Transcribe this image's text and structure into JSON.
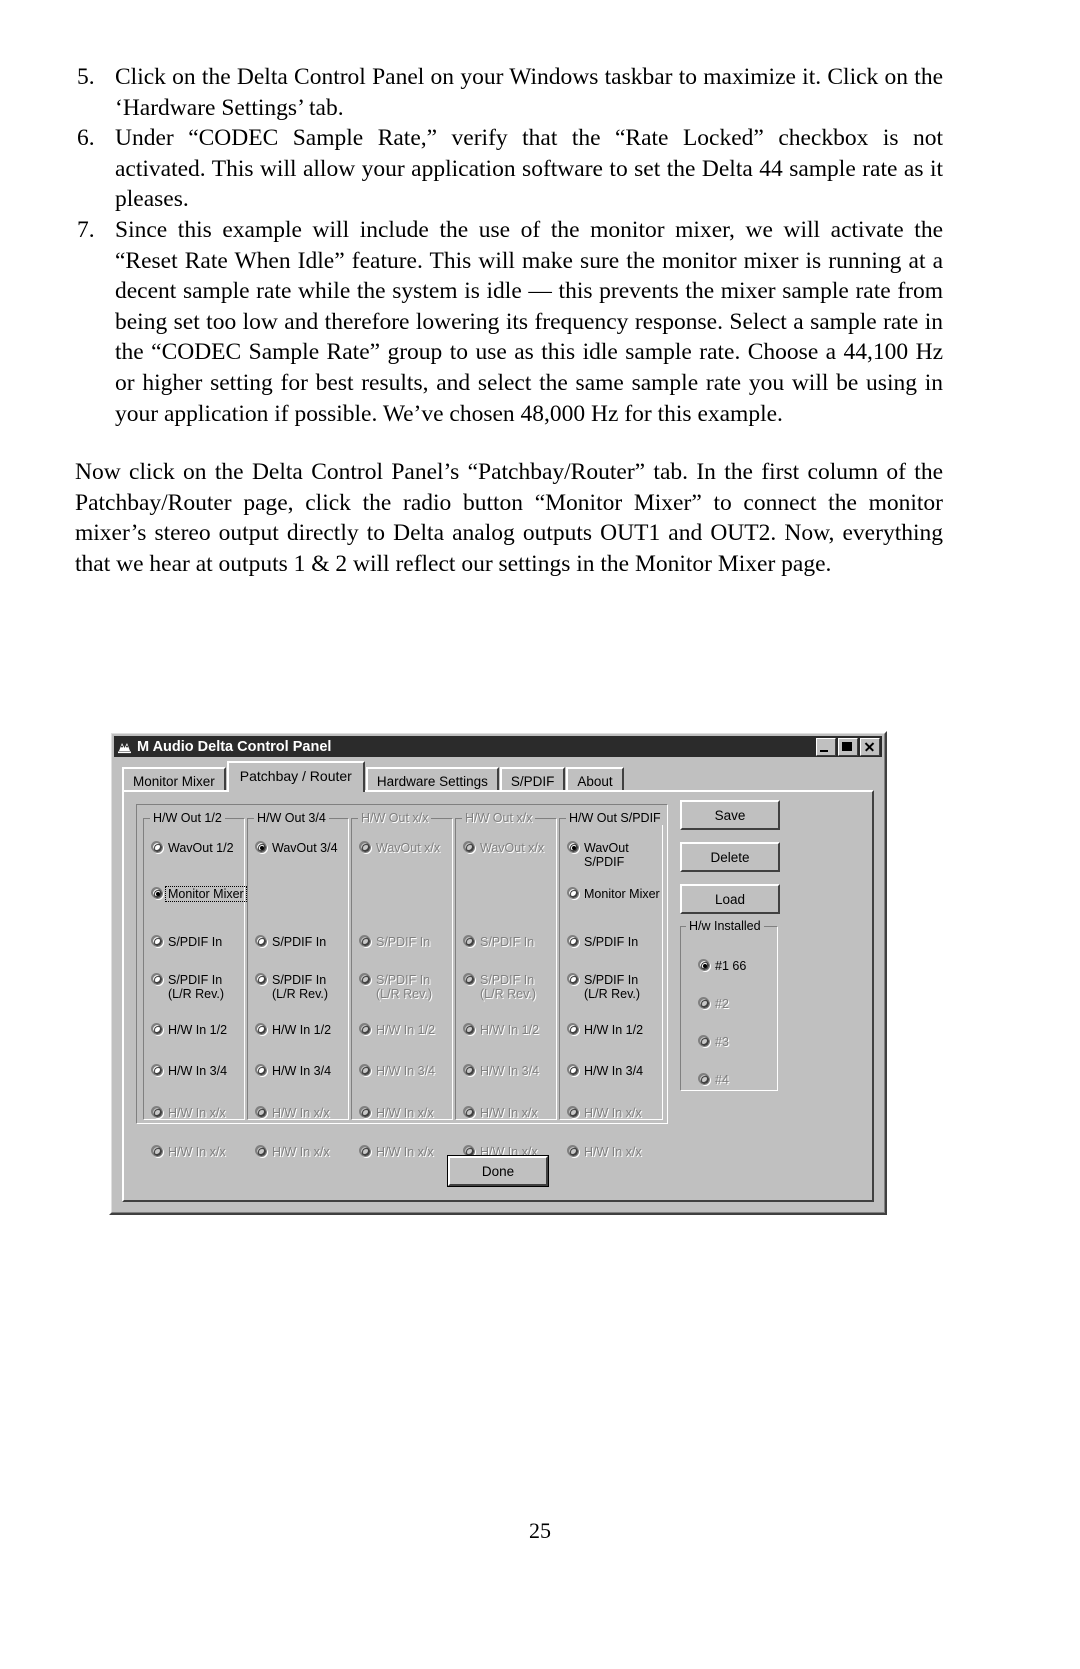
{
  "document": {
    "numbered_items": [
      {
        "num": "5.",
        "text": "Click on the Delta Control Panel on your Windows taskbar to maximize it.  Click on the ‘Hardware Settings’ tab."
      },
      {
        "num": "6.",
        "text": "Under “CODEC Sample Rate,” verify that the “Rate Locked” checkbox is not activated.  This will allow your application software to set the Delta 44 sample rate as it pleases."
      },
      {
        "num": "7.",
        "text": "Since this example will include the use of the monitor mixer, we will activate the “Reset Rate When Idle” feature.  This will make sure the monitor mixer is running at a decent sample rate while the system is idle — this prevents the mixer sample rate from being set too low and therefore lowering its frequency response.  Select a sample rate in the “CODEC Sample Rate” group to use as this idle sample rate.  Choose a 44,100 Hz or higher setting for best results, and select the same sample rate you will be using in your application if possible. We’ve chosen 48,000 Hz for this example."
      }
    ],
    "paragraph": "Now click on the Delta Control Panel’s “Patchbay/Router” tab.  In the first column of the Patchbay/Router page, click the radio button “Monitor Mixer” to connect the monitor mixer’s stereo output directly to Delta analog outputs OUT1 and OUT2. Now, everything that we hear at outputs 1 & 2 will reflect our settings in the Monitor Mixer page.",
    "page_number": "25"
  },
  "dialog": {
    "title": "M Audio Delta Control Panel",
    "title_icon": "m-audio-logo-icon",
    "window_buttons": [
      {
        "name": "minimize-button",
        "glyph": "minimize-icon"
      },
      {
        "name": "maximize-button",
        "glyph": "maximize-icon"
      },
      {
        "name": "close-button",
        "glyph": "close-icon"
      }
    ],
    "tabs": [
      {
        "label": "Monitor Mixer",
        "active": false
      },
      {
        "label": "Patchbay / Router",
        "active": true
      },
      {
        "label": "Hardware Settings",
        "active": false
      },
      {
        "label": "S/PDIF",
        "active": false
      },
      {
        "label": "About",
        "active": false
      }
    ],
    "columns": [
      {
        "title": "H/W Out 1/2",
        "disabled": false,
        "options": [
          {
            "label": "WavOut 1/2",
            "selected": false,
            "disabled": false,
            "focused": false
          },
          {
            "label": "Monitor Mixer",
            "selected": true,
            "disabled": false,
            "focused": true
          },
          {
            "label": "S/PDIF In",
            "selected": false,
            "disabled": false,
            "focused": false
          },
          {
            "label": "S/PDIF In\n(L/R Rev.)",
            "selected": false,
            "disabled": false,
            "focused": false
          },
          {
            "label": "H/W In 1/2",
            "selected": false,
            "disabled": false,
            "focused": false
          },
          {
            "label": "H/W In 3/4",
            "selected": false,
            "disabled": false,
            "focused": false
          },
          {
            "label": "H/W In x/x",
            "selected": false,
            "disabled": true,
            "focused": false
          },
          {
            "label": "H/W In x/x",
            "selected": false,
            "disabled": true,
            "focused": false
          }
        ]
      },
      {
        "title": "H/W Out 3/4",
        "disabled": false,
        "options": [
          {
            "label": "WavOut 3/4",
            "selected": true,
            "disabled": false,
            "focused": false
          },
          {
            "label": "",
            "selected": false,
            "disabled": false,
            "focused": false,
            "hidden": true
          },
          {
            "label": "S/PDIF In",
            "selected": false,
            "disabled": false,
            "focused": false
          },
          {
            "label": "S/PDIF In\n(L/R Rev.)",
            "selected": false,
            "disabled": false,
            "focused": false
          },
          {
            "label": "H/W In 1/2",
            "selected": false,
            "disabled": false,
            "focused": false
          },
          {
            "label": "H/W In 3/4",
            "selected": false,
            "disabled": false,
            "focused": false
          },
          {
            "label": "H/W In x/x",
            "selected": false,
            "disabled": true,
            "focused": false
          },
          {
            "label": "H/W In x/x",
            "selected": false,
            "disabled": true,
            "focused": false
          }
        ]
      },
      {
        "title": "H/W Out x/x",
        "disabled": true,
        "options": [
          {
            "label": "WavOut x/x",
            "selected": false,
            "disabled": true,
            "focused": false
          },
          {
            "label": "",
            "selected": false,
            "disabled": true,
            "focused": false,
            "hidden": true
          },
          {
            "label": "S/PDIF In",
            "selected": false,
            "disabled": true,
            "focused": false
          },
          {
            "label": "S/PDIF In\n(L/R Rev.)",
            "selected": false,
            "disabled": true,
            "focused": false
          },
          {
            "label": "H/W In 1/2",
            "selected": false,
            "disabled": true,
            "focused": false
          },
          {
            "label": "H/W In 3/4",
            "selected": false,
            "disabled": true,
            "focused": false
          },
          {
            "label": "H/W In x/x",
            "selected": false,
            "disabled": true,
            "focused": false
          },
          {
            "label": "H/W In x/x",
            "selected": false,
            "disabled": true,
            "focused": false
          }
        ]
      },
      {
        "title": "H/W Out x/x",
        "disabled": true,
        "options": [
          {
            "label": "WavOut x/x",
            "selected": false,
            "disabled": true,
            "focused": false
          },
          {
            "label": "",
            "selected": false,
            "disabled": true,
            "focused": false,
            "hidden": true
          },
          {
            "label": "S/PDIF In",
            "selected": false,
            "disabled": true,
            "focused": false
          },
          {
            "label": "S/PDIF In\n(L/R Rev.)",
            "selected": false,
            "disabled": true,
            "focused": false
          },
          {
            "label": "H/W In 1/2",
            "selected": false,
            "disabled": true,
            "focused": false
          },
          {
            "label": "H/W In 3/4",
            "selected": false,
            "disabled": true,
            "focused": false
          },
          {
            "label": "H/W In x/x",
            "selected": false,
            "disabled": true,
            "focused": false
          },
          {
            "label": "H/W In x/x",
            "selected": false,
            "disabled": true,
            "focused": false
          }
        ]
      },
      {
        "title": "H/W Out S/PDIF",
        "disabled": false,
        "options": [
          {
            "label": "WavOut\nS/PDIF",
            "selected": true,
            "disabled": false,
            "focused": false
          },
          {
            "label": "Monitor Mixer",
            "selected": false,
            "disabled": false,
            "focused": false
          },
          {
            "label": "S/PDIF In",
            "selected": false,
            "disabled": false,
            "focused": false
          },
          {
            "label": "S/PDIF In\n(L/R Rev.)",
            "selected": false,
            "disabled": false,
            "focused": false
          },
          {
            "label": "H/W In 1/2",
            "selected": false,
            "disabled": false,
            "focused": false
          },
          {
            "label": "H/W In 3/4",
            "selected": false,
            "disabled": false,
            "focused": false
          },
          {
            "label": "H/W In x/x",
            "selected": false,
            "disabled": true,
            "focused": false
          },
          {
            "label": "H/W In x/x",
            "selected": false,
            "disabled": true,
            "focused": false
          }
        ]
      }
    ],
    "side_buttons": [
      {
        "label": "Save"
      },
      {
        "label": "Delete"
      },
      {
        "label": "Load"
      }
    ],
    "hw_installed": {
      "title": "H/w Installed",
      "options": [
        {
          "label": "#1 66",
          "selected": true,
          "disabled": false
        },
        {
          "label": "#2",
          "selected": false,
          "disabled": true
        },
        {
          "label": "#3",
          "selected": false,
          "disabled": true
        },
        {
          "label": "#4",
          "selected": false,
          "disabled": true
        }
      ]
    },
    "done_button": "Done"
  },
  "colors": {
    "face": "#c0c0c0",
    "titlebar": "#2b2b2b",
    "shadow": "#808080",
    "dark": "#404040",
    "light": "#ffffff"
  }
}
